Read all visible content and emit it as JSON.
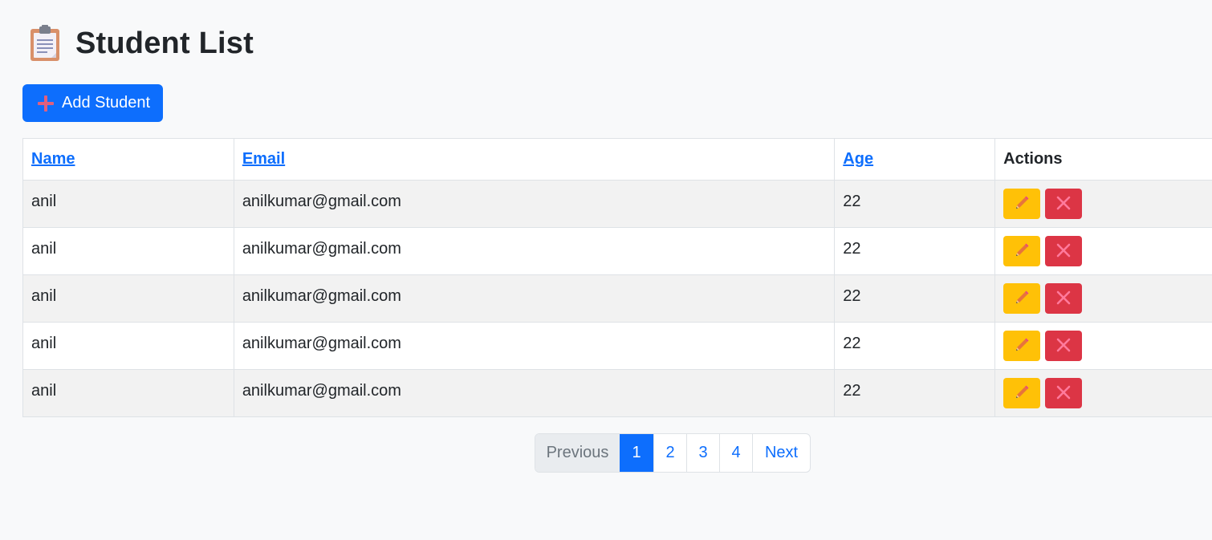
{
  "header": {
    "icon": "clipboard-icon",
    "title": "Student List"
  },
  "toolbar": {
    "add_icon": "plus-icon",
    "add_label": "Add Student"
  },
  "table": {
    "columns": {
      "name": "Name",
      "email": "Email",
      "age": "Age",
      "actions": "Actions"
    },
    "rows": [
      {
        "name": "anil",
        "email": "anilkumar@gmail.com",
        "age": "22"
      },
      {
        "name": "anil",
        "email": "anilkumar@gmail.com",
        "age": "22"
      },
      {
        "name": "anil",
        "email": "anilkumar@gmail.com",
        "age": "22"
      },
      {
        "name": "anil",
        "email": "anilkumar@gmail.com",
        "age": "22"
      },
      {
        "name": "anil",
        "email": "anilkumar@gmail.com",
        "age": "22"
      }
    ],
    "row_actions": {
      "edit_icon": "pencil-icon",
      "delete_icon": "close-icon"
    }
  },
  "pagination": {
    "previous_label": "Previous",
    "pages": [
      "1",
      "2",
      "3",
      "4"
    ],
    "current_page": "1",
    "next_label": "Next"
  },
  "colors": {
    "primary": "#0d6efd",
    "warning": "#ffc107",
    "danger": "#dc3545",
    "background": "#f8f9fa",
    "stripe": "#f2f2f2"
  }
}
